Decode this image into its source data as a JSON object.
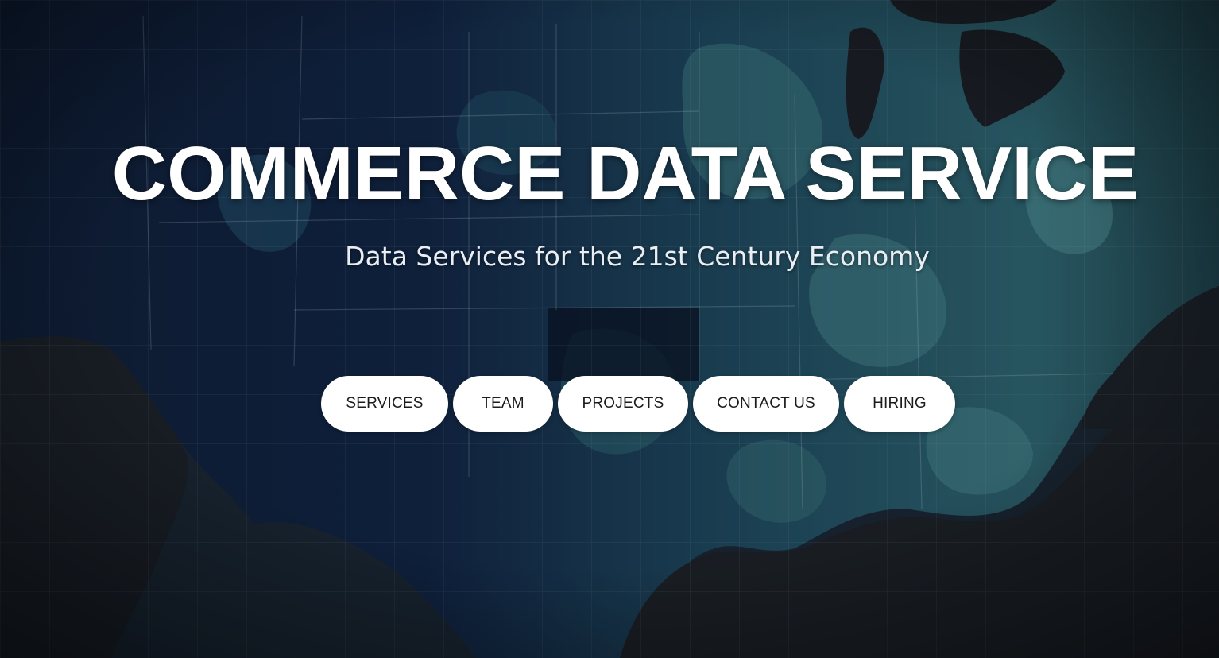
{
  "hero": {
    "title": "COMMERCE DATA SERVICE",
    "subtitle": "Data Services for the 21st Century Economy",
    "background_icon": "us-map-background",
    "colors": {
      "button_bg": "#ffffff",
      "button_text": "#1c1c1c",
      "title_text": "#ffffff",
      "map_dark": "#0d1a2b",
      "map_teal": "#3f7f88"
    }
  },
  "nav": {
    "items": [
      {
        "label": "SERVICES"
      },
      {
        "label": "TEAM"
      },
      {
        "label": "PROJECTS"
      },
      {
        "label": "CONTACT US"
      },
      {
        "label": "HIRING"
      }
    ]
  }
}
